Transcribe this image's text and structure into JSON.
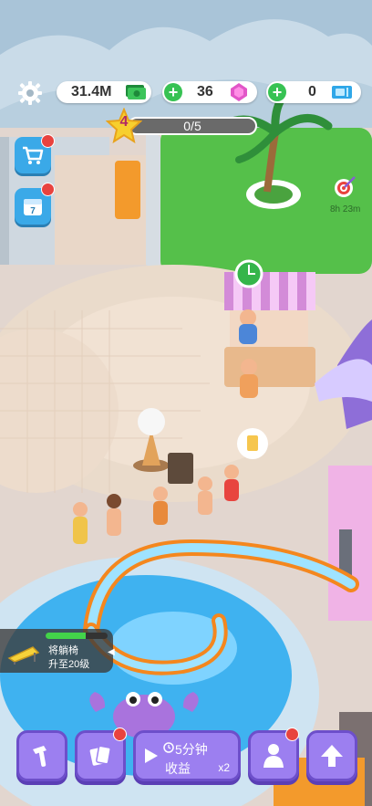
{
  "resources": {
    "cash": "31.4M",
    "gems": "36",
    "tickets": "0"
  },
  "level": {
    "number": "4",
    "progress_text": "0/5",
    "progress": 0
  },
  "timer": {
    "text": "8h 23m"
  },
  "task": {
    "line1": "将躺椅",
    "line2": "升至20级",
    "progress": 0.65
  },
  "earn_button": {
    "line1": "5分钟",
    "line2": "收益",
    "multiplier": "x2"
  },
  "icons": {
    "settings": "gear-icon",
    "shop": "cart-icon",
    "calendar": "calendar-icon",
    "cash": "cash-icon",
    "gem": "gem-icon",
    "ticket": "ticket-icon",
    "target": "target-icon",
    "build": "hammer-icon",
    "cards": "cards-icon",
    "video": "play-icon",
    "clock": "clock-icon",
    "staff": "person-icon",
    "upgrade": "up-arrow-icon",
    "lounger": "sunlounger-icon",
    "drink": "drink-icon"
  },
  "colors": {
    "accent_purple": "#9c7ff0",
    "accent_blue": "#3aa9e8",
    "notification_red": "#e8433f",
    "plus_green": "#37c253"
  }
}
